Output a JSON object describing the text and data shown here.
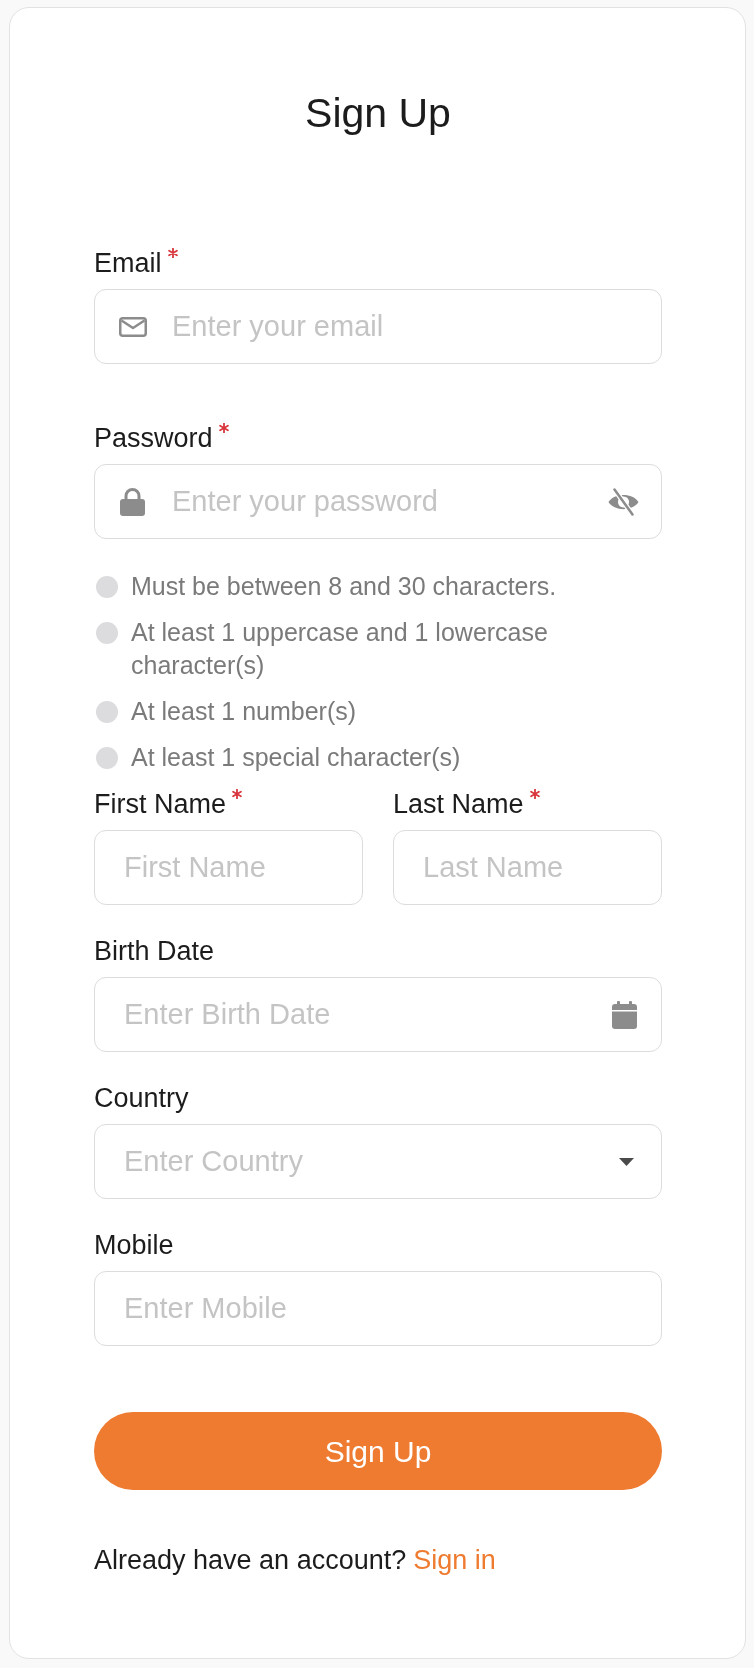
{
  "title": "Sign Up",
  "fields": [
    {
      "kind": "email",
      "label": "Email",
      "required": true,
      "placeholder": "Enter your email"
    },
    {
      "kind": "password",
      "label": "Password",
      "required": true,
      "placeholder": "Enter your password",
      "revealed": false,
      "rules": [
        {
          "text": "Must be between 8 and 30 characters.",
          "met": false
        },
        {
          "text": "At least 1 uppercase and 1 lowercase character(s)",
          "met": false
        },
        {
          "text": "At least 1 number(s)",
          "met": false
        },
        {
          "text": "At least 1 special character(s)",
          "met": false
        }
      ]
    },
    {
      "kind": "row",
      "fields": [
        {
          "kind": "text",
          "label": "First Name",
          "required": true,
          "placeholder": "First Name"
        },
        {
          "kind": "text",
          "label": "Last Name",
          "required": true,
          "placeholder": "Last Name"
        }
      ]
    },
    {
      "kind": "date",
      "label": "Birth Date",
      "required": false,
      "placeholder": "Enter Birth Date"
    },
    {
      "kind": "select",
      "label": "Country",
      "required": false,
      "placeholder": "Enter Country"
    },
    {
      "kind": "text",
      "label": "Mobile",
      "required": false,
      "placeholder": "Enter Mobile"
    }
  ],
  "submit_button": {
    "label": "Sign Up"
  },
  "footer": {
    "text": "Already have an account?",
    "link": "Sign in"
  }
}
